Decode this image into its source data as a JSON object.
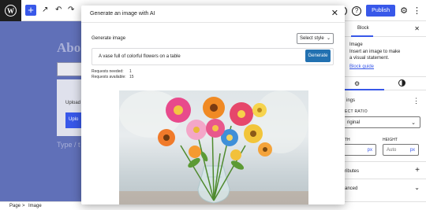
{
  "toolbar": {
    "add_label": "+",
    "publish_label": "Publish",
    "plugin_badge_label": "G",
    "help_label": "?"
  },
  "canvas": {
    "title": "Abo",
    "upload_text": "Upload",
    "upload_button": "Uplo",
    "type_hint": "Type / t"
  },
  "sidebar": {
    "tab_block": "Block",
    "description_title": "Image",
    "description": "Insert an image to make a visual statement.",
    "guide_link": "Block guide",
    "settings_label": "ings",
    "aspect_ratio_label": "ECT RATIO",
    "aspect_ratio_value": "riginal",
    "width_label": "TH",
    "height_label": "HEIGHT",
    "width_unit": "px",
    "height_placeholder": "Auto",
    "height_unit": "px",
    "attributes_label": "ributes",
    "advanced_label": "anced"
  },
  "breadcrumb": {
    "page": "Page",
    "separator": ">",
    "image": "Image"
  },
  "modal": {
    "title": "Generate an image with AI",
    "generate_label": "Generate image",
    "style_select": "Select style",
    "prompt_value": "A vase full of colorful flowers on a table",
    "generate_button": "Generate",
    "requests_needed_label": "Requests needed:",
    "requests_needed_value": "1",
    "requests_available_label": "Requests available:",
    "requests_available_value": "15"
  },
  "colors": {
    "accent": "#3858e9",
    "generate_button": "#2271b1",
    "canvas_bg": "#6070b8"
  }
}
